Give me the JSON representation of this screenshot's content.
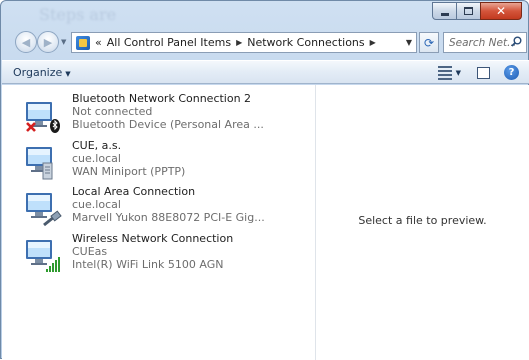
{
  "window": {
    "title_ghost": "Steps are"
  },
  "address_bar": {
    "overflow": "«",
    "breadcrumbs": [
      "All Control Panel Items",
      "Network Connections"
    ]
  },
  "search": {
    "placeholder": "Search Net..."
  },
  "toolbar": {
    "organize_label": "Organize"
  },
  "connections": [
    {
      "name": "Bluetooth Network Connection 2",
      "status": "Not connected",
      "device": "Bluetooth Device (Personal Area ...",
      "badge": "disconnected-x-icon"
    },
    {
      "name": "CUE, a.s.",
      "status": "cue.local",
      "device": "WAN Miniport (PPTP)",
      "badge": "vpn-server-icon"
    },
    {
      "name": "Local Area Connection",
      "status": "cue.local",
      "device": "Marvell Yukon 88E8072 PCI-E Gig...",
      "badge": "ethernet-cable-icon"
    },
    {
      "name": "Wireless Network Connection",
      "status": "CUEas",
      "device": "Intel(R) WiFi Link 5100 AGN",
      "badge": "wifi-signal-icon"
    }
  ],
  "preview": {
    "message": "Select a file to preview."
  },
  "colors": {
    "frame": "#bfd3ea",
    "toolbar": "#e3ecf6",
    "link_text": "#1e395b",
    "secondary_text": "#6d6d6d",
    "close_button": "#d4553b"
  }
}
